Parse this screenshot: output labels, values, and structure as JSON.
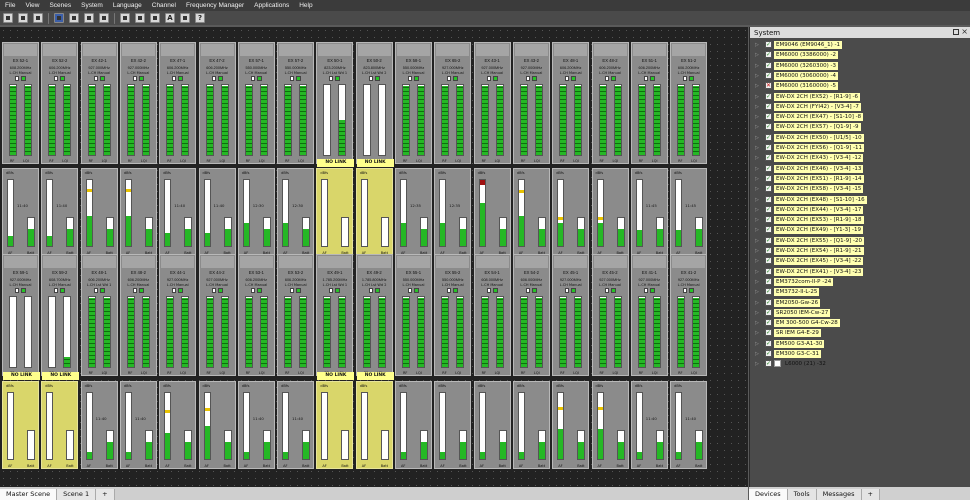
{
  "menu": [
    "File",
    "View",
    "Scenes",
    "System",
    "Language",
    "Channel",
    "Frequency Manager",
    "Applications",
    "Help"
  ],
  "toolbar_icons": [
    "new-icon",
    "open-icon",
    "print-icon",
    "sep",
    "settings-icon",
    "cut-icon",
    "copy-icon",
    "receiver-icon",
    "sep",
    "scan-icon",
    "transmit-icon",
    "mute-icon",
    "font-icon",
    "grid-icon",
    "help-icon"
  ],
  "top_row": [
    {
      "name": "EX 52-1",
      "freq": "608.200MHz",
      "sub": "L.CH Manual",
      "rf": 0.98,
      "lqi": 0.98
    },
    {
      "name": "EX 52-2",
      "freq": "606.200MHz",
      "sub": "L.CH Manual",
      "rf": 0.98,
      "lqi": 0.98
    },
    {
      "name": "EX 42-1",
      "freq": "927.000MHz",
      "sub": "L.CH Manual",
      "rf": 0.98,
      "lqi": 0.98
    },
    {
      "name": "EX 42-2",
      "freq": "927.000MHz",
      "sub": "L.CH Manual",
      "rf": 0.98,
      "lqi": 0.98
    },
    {
      "name": "EX 47-1",
      "freq": "606.200MHz",
      "sub": "L.CH Manual",
      "rf": 0.98,
      "lqi": 0.98
    },
    {
      "name": "EX 47-2",
      "freq": "606.200MHz",
      "sub": "L.CH Manual",
      "rf": 0.98,
      "lqi": 0.98
    },
    {
      "name": "EX 57-1",
      "freq": "550.000MHz",
      "sub": "L.CH Manual",
      "rf": 0.98,
      "lqi": 0.98
    },
    {
      "name": "EX 57-2",
      "freq": "550.000MHz",
      "sub": "L.CH Manual",
      "rf": 0.98,
      "lqi": 0.98
    },
    {
      "name": "EX 50-1",
      "freq": "823.200MHz",
      "sub": "L.CH Lst Wd 1",
      "rf": 0.0,
      "lqi": 0.5
    },
    {
      "name": "EX 50-2",
      "freq": "823.800MHz",
      "sub": "L.CH Lst Wd 2",
      "rf": 0.0,
      "lqi": 0.0
    },
    {
      "name": "EX 58-1",
      "freq": "550.000MHz",
      "sub": "L.CH Manual",
      "rf": 0.98,
      "lqi": 0.98
    },
    {
      "name": "EX 65-2",
      "freq": "927.000MHz",
      "sub": "L.CH Manual",
      "rf": 0.98,
      "lqi": 0.98
    },
    {
      "name": "EX 43-1",
      "freq": "927.000MHz",
      "sub": "L.CH Manual",
      "rf": 0.98,
      "lqi": 0.98
    },
    {
      "name": "EX 43-2",
      "freq": "927.000MHz",
      "sub": "L.CH Manual",
      "rf": 0.98,
      "lqi": 0.98
    },
    {
      "name": "EX 48-1",
      "freq": "606.200MHz",
      "sub": "L.CH Manual",
      "rf": 0.98,
      "lqi": 0.98
    },
    {
      "name": "EX 48-2",
      "freq": "606.200MHz",
      "sub": "L.CH Manual",
      "rf": 0.98,
      "lqi": 0.98
    },
    {
      "name": "EX 51-1",
      "freq": "606.200MHz",
      "sub": "L.CH Manual",
      "rf": 0.98,
      "lqi": 0.98
    },
    {
      "name": "EX 51-2",
      "freq": "606.200MHz",
      "sub": "L.CH Manual",
      "rf": 0.98,
      "lqi": 0.98
    }
  ],
  "top_audio": [
    {
      "time": "11:40",
      "af": 0.15,
      "bat": 0.6,
      "peak": null,
      "nolink": false
    },
    {
      "time": "11:40",
      "af": 0.15,
      "bat": 0.6,
      "peak": null,
      "nolink": false
    },
    {
      "time": "",
      "af": 0.45,
      "bat": 0.6,
      "peak": 0.82,
      "nolink": false
    },
    {
      "time": "",
      "af": 0.45,
      "bat": 0.6,
      "peak": 0.82,
      "nolink": false
    },
    {
      "time": "11:40",
      "af": 0.2,
      "bat": 0.6,
      "peak": null,
      "nolink": false
    },
    {
      "time": "11:40",
      "af": 0.2,
      "bat": 0.6,
      "peak": null,
      "nolink": false
    },
    {
      "time": "12:30",
      "af": 0.35,
      "bat": 0.6,
      "peak": null,
      "nolink": false
    },
    {
      "time": "12:30",
      "af": 0.35,
      "bat": 0.6,
      "peak": null,
      "nolink": false
    },
    {
      "time": "",
      "af": 0.0,
      "bat": 0.0,
      "peak": null,
      "nolink": true
    },
    {
      "time": "",
      "af": 0.0,
      "bat": 0.0,
      "peak": null,
      "nolink": true
    },
    {
      "time": "12:35",
      "af": 0.35,
      "bat": 0.6,
      "peak": null,
      "nolink": false
    },
    {
      "time": "12:35",
      "af": 0.35,
      "bat": 0.6,
      "peak": null,
      "nolink": false
    },
    {
      "time": "",
      "af": 0.65,
      "bat": 0.6,
      "peak": 0.93,
      "red": true,
      "nolink": false
    },
    {
      "time": "",
      "af": 0.45,
      "bat": 0.6,
      "peak": 0.8,
      "nolink": false
    },
    {
      "time": "",
      "af": 0.35,
      "bat": 0.6,
      "peak": 0.4,
      "nolink": false
    },
    {
      "time": "",
      "af": 0.35,
      "bat": 0.6,
      "peak": 0.4,
      "nolink": false
    },
    {
      "time": "11:45",
      "af": 0.25,
      "bat": 0.6,
      "peak": null,
      "nolink": false
    },
    {
      "time": "11:45",
      "af": 0.25,
      "bat": 0.6,
      "peak": null,
      "nolink": false
    }
  ],
  "bottom_row": [
    {
      "name": "EX 59-1",
      "freq": "927.000MHz",
      "sub": "L.CH Manual",
      "rf": 0.0,
      "lqi": 0.0
    },
    {
      "name": "EX 59-2",
      "freq": "608.700MHz",
      "sub": "L.CH Manual",
      "rf": 0.0,
      "lqi": 0.15
    },
    {
      "name": "EX 48-1",
      "freq": "606.200MHz",
      "sub": "L.CH Lst Wd 1",
      "rf": 0.98,
      "lqi": 0.98
    },
    {
      "name": "EX 48-2",
      "freq": "606.200MHz",
      "sub": "L.CH Manual",
      "rf": 0.98,
      "lqi": 0.98
    },
    {
      "name": "EX 44-1",
      "freq": "927.000MHz",
      "sub": "L.CH Manual",
      "rf": 0.98,
      "lqi": 0.98
    },
    {
      "name": "EX 44-2",
      "freq": "927.000MHz",
      "sub": "L.CH Manual",
      "rf": 0.98,
      "lqi": 0.98
    },
    {
      "name": "EX 53-1",
      "freq": "606.200MHz",
      "sub": "L.CH Manual",
      "rf": 0.98,
      "lqi": 0.98
    },
    {
      "name": "EX 53-2",
      "freq": "606.200MHz",
      "sub": "L.CH Manual",
      "rf": 0.98,
      "lqi": 0.98
    },
    {
      "name": "EX 49-1",
      "freq": "1.785.200MHz",
      "sub": "L.CH Lst Wd 1",
      "rf": 0.98,
      "lqi": 0.98
    },
    {
      "name": "EX 49-2",
      "freq": "1.785.800MHz",
      "sub": "L.CH Lst Wd 2",
      "rf": 0.98,
      "lqi": 0.98
    },
    {
      "name": "EX 55-1",
      "freq": "550.000MHz",
      "sub": "L.CH Manual",
      "rf": 0.98,
      "lqi": 0.98
    },
    {
      "name": "EX 55-2",
      "freq": "550.000MHz",
      "sub": "L.CH Manual",
      "rf": 0.98,
      "lqi": 0.98
    },
    {
      "name": "EX 54-1",
      "freq": "608.000MHz",
      "sub": "L.CH Manual",
      "rf": 0.98,
      "lqi": 0.98
    },
    {
      "name": "EX 54-2",
      "freq": "606.000MHz",
      "sub": "L.CH Manual",
      "rf": 0.98,
      "lqi": 0.98
    },
    {
      "name": "EX 45-1",
      "freq": "927.000MHz",
      "sub": "L.CH Manual",
      "rf": 0.98,
      "lqi": 0.98
    },
    {
      "name": "EX 45-2",
      "freq": "927.000MHz",
      "sub": "L.CH Manual",
      "rf": 0.98,
      "lqi": 0.98
    },
    {
      "name": "EX 41-1",
      "freq": "927.000MHz",
      "sub": "L.CH Manual",
      "rf": 0.98,
      "lqi": 0.98
    },
    {
      "name": "EX 41-2",
      "freq": "927.000MHz",
      "sub": "L.CH Manual",
      "rf": 0.98,
      "lqi": 0.98
    }
  ],
  "bottom_audio": [
    {
      "time": "",
      "af": 0.0,
      "bat": 0.0,
      "peak": null,
      "nolink": true
    },
    {
      "time": "",
      "af": 0.0,
      "bat": 0.0,
      "peak": null,
      "nolink": true
    },
    {
      "time": "11:40",
      "af": 0.1,
      "bat": 0.6,
      "peak": null,
      "nolink": false
    },
    {
      "time": "11:40",
      "af": 0.1,
      "bat": 0.6,
      "peak": null,
      "nolink": false
    },
    {
      "time": "",
      "af": 0.4,
      "bat": 0.6,
      "peak": 0.7,
      "nolink": false
    },
    {
      "time": "",
      "af": 0.5,
      "bat": 0.6,
      "peak": 0.72,
      "nolink": false
    },
    {
      "time": "11:40",
      "af": 0.1,
      "bat": 0.6,
      "peak": null,
      "nolink": false
    },
    {
      "time": "11:40",
      "af": 0.1,
      "bat": 0.6,
      "peak": null,
      "nolink": false
    },
    {
      "time": "",
      "af": 0.0,
      "bat": 0.0,
      "peak": null,
      "nolink": true
    },
    {
      "time": "",
      "af": 0.0,
      "bat": 0.0,
      "peak": null,
      "nolink": true
    },
    {
      "time": "",
      "af": 0.1,
      "bat": 0.6,
      "peak": null,
      "nolink": false
    },
    {
      "time": "",
      "af": 0.1,
      "bat": 0.6,
      "peak": null,
      "nolink": false
    },
    {
      "time": "",
      "af": 0.1,
      "bat": 0.6,
      "peak": null,
      "nolink": false
    },
    {
      "time": "",
      "af": 0.1,
      "bat": 0.6,
      "peak": null,
      "nolink": false
    },
    {
      "time": "",
      "af": 0.45,
      "bat": 0.6,
      "peak": 0.75,
      "nolink": false
    },
    {
      "time": "",
      "af": 0.45,
      "bat": 0.6,
      "peak": 0.75,
      "nolink": false
    },
    {
      "time": "11:40",
      "af": 0.1,
      "bat": 0.6,
      "peak": null,
      "nolink": false
    },
    {
      "time": "11:40",
      "af": 0.1,
      "bat": 0.6,
      "peak": null,
      "nolink": false
    }
  ],
  "labels": {
    "rf": "RF",
    "lqi": "LQI",
    "af": "AF",
    "bat": "Batt",
    "dbfs": "dBfs",
    "nolink": "NO LINK",
    "lq": "LQ",
    "dbm": "dBm A  B"
  },
  "system_panel": {
    "title": "System",
    "items": [
      {
        "label": "EM9046 (EM9046_1) -1",
        "status": "ok",
        "style": "yellow"
      },
      {
        "label": "EM6000 (3386000) -2",
        "status": "ok",
        "style": "yellow"
      },
      {
        "label": "EM6000 (3260300) -3",
        "status": "ok",
        "style": "yellow"
      },
      {
        "label": "EM6000 (3060000) -4",
        "status": "ok",
        "style": "yellow"
      },
      {
        "label": "EM6000 (3160000) -5",
        "status": "err",
        "style": "yellow"
      },
      {
        "label": "EW-DX 2CH (EX52) - [R1-9] -6",
        "status": "ok",
        "style": "yellow"
      },
      {
        "label": "EW-DX 2CH (FYI42) - [V3-4] -7",
        "status": "ok",
        "style": "yellow"
      },
      {
        "label": "EW-DX 2CH (EX47) - [S1-10] -8",
        "status": "ok",
        "style": "yellow"
      },
      {
        "label": "EW-DX 2CH (EX57) - [Q1-9] -9",
        "status": "ok",
        "style": "yellow"
      },
      {
        "label": "EW-DX 2CH (EX50) - [U1/5] -10",
        "status": "ok",
        "style": "yellow"
      },
      {
        "label": "EW-DX 2CH (EX56) - [Q1-9] -11",
        "status": "ok",
        "style": "yellow"
      },
      {
        "label": "EW-DX 2CH (EX43) - [V3-4] -12",
        "status": "ok",
        "style": "yellow"
      },
      {
        "label": "EW-DX 2CH (EX46) - [V3-4] -13",
        "status": "ok",
        "style": "yellow"
      },
      {
        "label": "EW-DX 2CH (EX51) - [R1-9] -14",
        "status": "ok",
        "style": "yellow"
      },
      {
        "label": "EW-DX 2CH (EX58) - [V3-4] -15",
        "status": "ok",
        "style": "yellow"
      },
      {
        "label": "EW-DX 2CH (EX48) - [S1-10] -16",
        "status": "ok",
        "style": "yellow"
      },
      {
        "label": "EW-DX 2CH (EX44) - [V3-4] -17",
        "status": "ok",
        "style": "yellow"
      },
      {
        "label": "EW-DX 2CH (EX53) - [R1-9] -18",
        "status": "ok",
        "style": "yellow"
      },
      {
        "label": "EW-DX 2CH (EX49) - [Y1-3] -19",
        "status": "ok",
        "style": "yellow"
      },
      {
        "label": "EW-DX 2CH (EX55) - [Q1-9] -20",
        "status": "ok",
        "style": "yellow"
      },
      {
        "label": "EW-DX 2CH (EX54) - [R1-9] -21",
        "status": "ok",
        "style": "yellow"
      },
      {
        "label": "EW-DX 2CH (EX45) - [V3-4] -22",
        "status": "ok",
        "style": "yellow"
      },
      {
        "label": "EW-DX 2CH (EX41) - [V3-4] -23",
        "status": "ok",
        "style": "yellow"
      },
      {
        "label": "EM3732com-II-P -24",
        "status": "ok",
        "style": "yellow"
      },
      {
        "label": "EM3732-II-L-25",
        "status": "ok",
        "style": "yellow"
      },
      {
        "label": "EM2050-Gw-26",
        "status": "ok",
        "style": "yellow"
      },
      {
        "label": "SR2050 IEM-Cw-27",
        "status": "ok",
        "style": "yellow"
      },
      {
        "label": "EM 300-500 G4-Cw-28",
        "status": "ok",
        "style": "yellow"
      },
      {
        "label": "SR IEM G4-E-29",
        "status": "ok",
        "style": "yellow"
      },
      {
        "label": "EM500 G3-A1-30",
        "status": "ok",
        "style": "yellow"
      },
      {
        "label": "EM300 G3-C-31",
        "status": "ok",
        "style": "yellow"
      },
      {
        "label": "L6000 (21) -32",
        "status": "ok",
        "style": "white-sq"
      }
    ]
  },
  "right_tabs": [
    "Devices",
    "Tools",
    "Messages",
    "+"
  ],
  "bottom_tabs": [
    "Master Scene",
    "Scene 1",
    "+"
  ]
}
